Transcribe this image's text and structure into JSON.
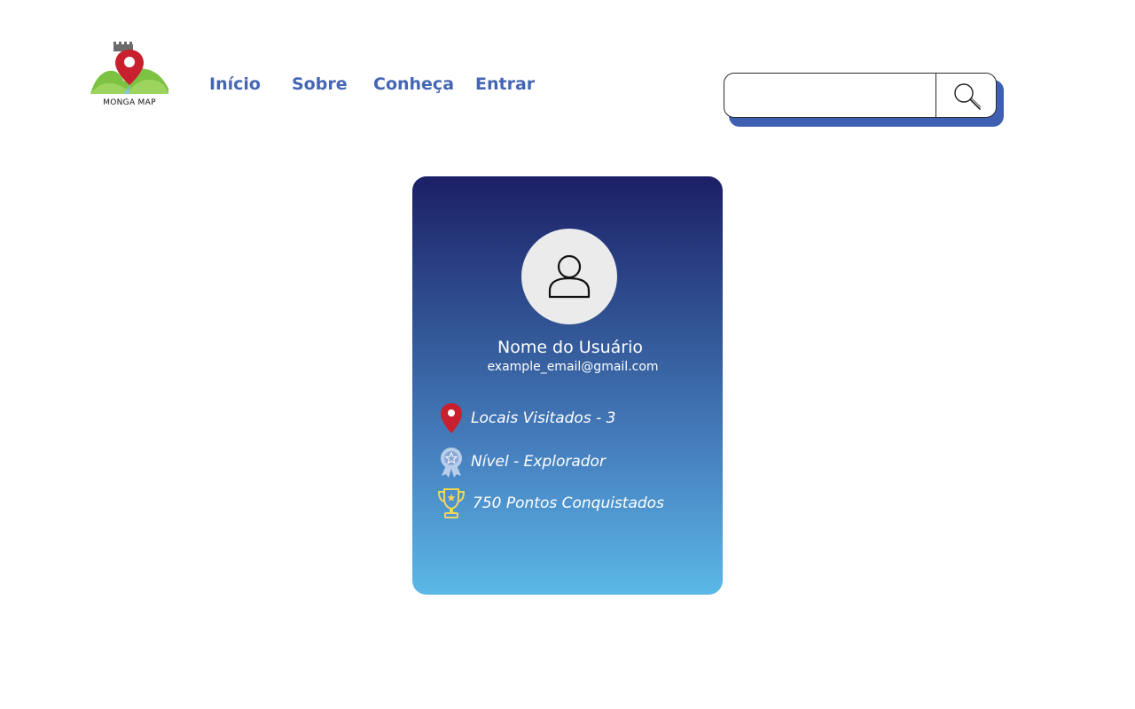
{
  "brand": {
    "logo_text": "MONGA MAP"
  },
  "nav": {
    "items": [
      {
        "label": "Início"
      },
      {
        "label": "Sobre"
      },
      {
        "label": "Conheça"
      },
      {
        "label": "Entrar"
      }
    ]
  },
  "search": {
    "value": "",
    "placeholder": "",
    "icon": "search-icon"
  },
  "profile": {
    "avatar_icon": "user-icon",
    "name": "Nome do Usuário",
    "email": "example_email@gmail.com",
    "stats": [
      {
        "icon": "map-pin-icon",
        "text": "Locais Visitados - 3"
      },
      {
        "icon": "medal-icon",
        "text": "Nível - Explorador"
      },
      {
        "icon": "trophy-icon",
        "text": "750 Pontos Conquistados"
      }
    ]
  },
  "colors": {
    "nav_link": "#4466b4",
    "search_shadow": "#3f5fb2",
    "card_gradient_top": "#1c1f66",
    "card_gradient_bottom": "#5bb8e6",
    "pin_red": "#c8202f",
    "trophy_gold": "#f1d45c"
  }
}
